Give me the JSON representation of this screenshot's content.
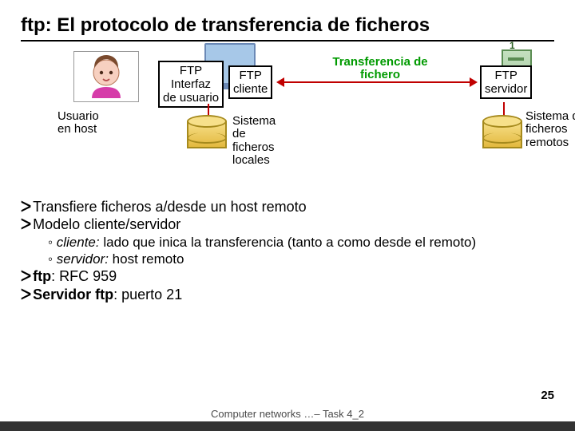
{
  "title": "ftp: El protocolo de transferencia de ficheros",
  "diagram": {
    "user_at_host": "Usuario\nen host",
    "ftp_ui_label": "FTP\nInterfaz\nde usuario",
    "ftp_client_label": "FTP\ncliente",
    "transfer_label": "Transferencia de\nfichero",
    "ftp_server_label": "FTP\nservidor",
    "local_fs": "Sistema\nde\nficheros\nlocales",
    "remote_fs": "Sistema de\nficheros\nremotos",
    "server_number": "1"
  },
  "bullets": {
    "b1_a": "Transfiere ",
    "b1_b": "ficheros a/desde un host remoto",
    "b2_a": "Modelo ",
    "b2_b": "cliente/servidor",
    "s1_a": "cliente:",
    "s1_b": " lado que inica la transferencia (tanto a como desde el remoto)",
    "s2_a": "servidor:",
    "s2_b": " host remoto",
    "b3_a": "ftp",
    "b3_b": ": RFC 959",
    "b4_a": "Servidor ftp",
    "b4_b": ": puerto 21"
  },
  "footer_text": "Computer networks …– Task 4_2",
  "page_number": "25"
}
